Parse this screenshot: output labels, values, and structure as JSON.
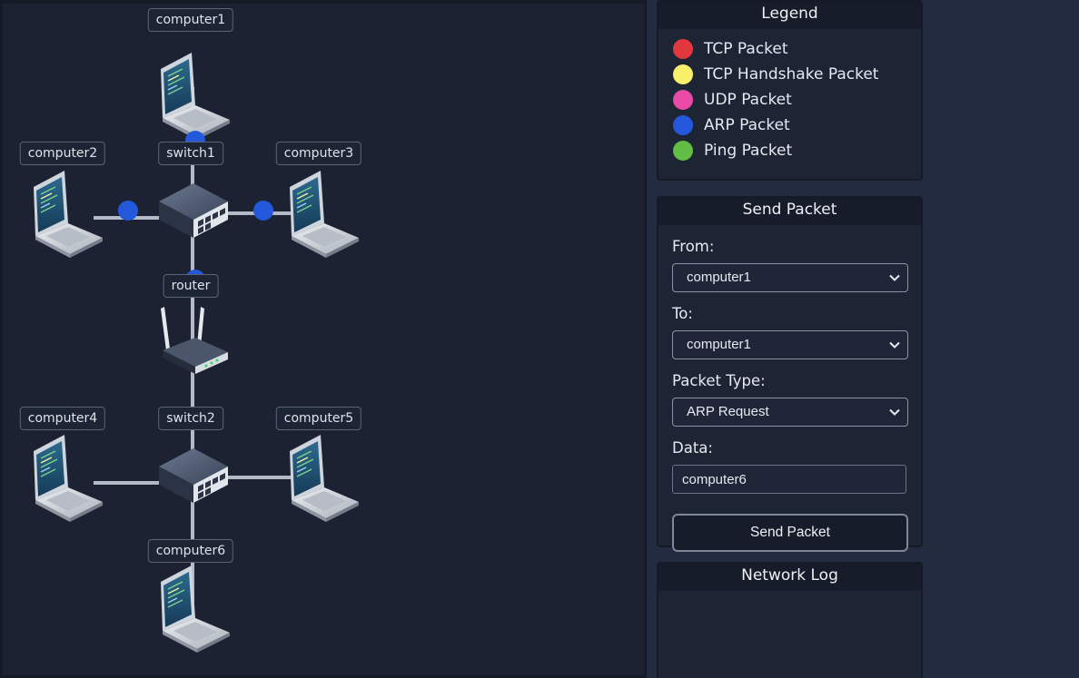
{
  "network": {
    "nodes": [
      {
        "id": "computer1",
        "label": "computer1",
        "type": "computer"
      },
      {
        "id": "computer2",
        "label": "computer2",
        "type": "computer"
      },
      {
        "id": "switch1",
        "label": "switch1",
        "type": "switch"
      },
      {
        "id": "computer3",
        "label": "computer3",
        "type": "computer"
      },
      {
        "id": "router",
        "label": "router",
        "type": "router"
      },
      {
        "id": "computer4",
        "label": "computer4",
        "type": "computer"
      },
      {
        "id": "switch2",
        "label": "switch2",
        "type": "switch"
      },
      {
        "id": "computer5",
        "label": "computer5",
        "type": "computer"
      },
      {
        "id": "computer6",
        "label": "computer6",
        "type": "computer"
      }
    ],
    "links": [
      [
        "computer1",
        "switch1"
      ],
      [
        "computer2",
        "switch1"
      ],
      [
        "computer3",
        "switch1"
      ],
      [
        "switch1",
        "router"
      ],
      [
        "router",
        "switch2"
      ],
      [
        "computer4",
        "switch2"
      ],
      [
        "computer5",
        "switch2"
      ],
      [
        "computer6",
        "switch2"
      ]
    ],
    "packets_in_flight": [
      {
        "type": "ARP Packet",
        "from": "computer1",
        "to": "switch1"
      },
      {
        "type": "ARP Packet",
        "from": "computer2",
        "to": "switch1"
      },
      {
        "type": "ARP Packet",
        "from": "computer3",
        "to": "switch1"
      },
      {
        "type": "ARP Packet",
        "from": "router",
        "to": "switch1"
      }
    ]
  },
  "legend": {
    "title": "Legend",
    "items": [
      {
        "label": "TCP Packet",
        "color": "#e0383e"
      },
      {
        "label": "TCP Handshake Packet",
        "color": "#f8ef6a"
      },
      {
        "label": "UDP Packet",
        "color": "#e84aa6"
      },
      {
        "label": "ARP Packet",
        "color": "#2358dd"
      },
      {
        "label": "Ping Packet",
        "color": "#63bd45"
      }
    ]
  },
  "send_packet": {
    "title": "Send Packet",
    "from_label": "From:",
    "from_value": "computer1",
    "to_label": "To:",
    "to_value": "computer1",
    "type_label": "Packet Type:",
    "type_value": "ARP Request",
    "data_label": "Data:",
    "data_value": "computer6",
    "button_label": "Send Packet"
  },
  "network_log": {
    "title": "Network Log",
    "entries": []
  }
}
